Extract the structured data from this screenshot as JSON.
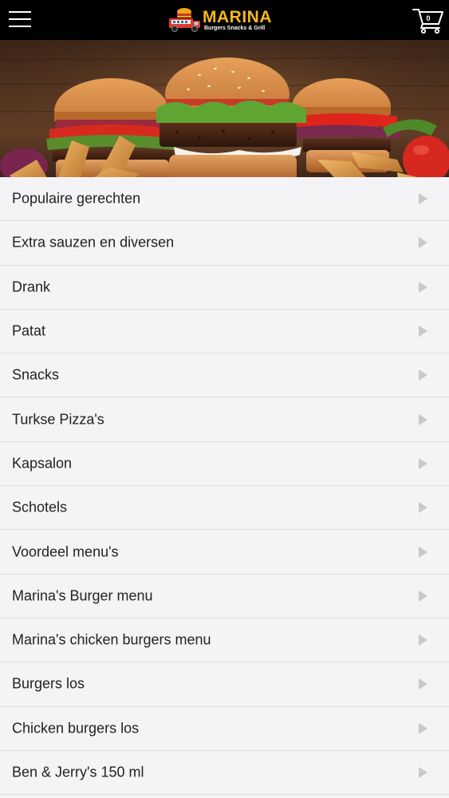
{
  "header": {
    "menu_icon": "hamburger-menu-icon",
    "brand": {
      "name": "MARINA",
      "tagline": "Burgers Snacks & Grill",
      "logo_icon": "food-truck-logo"
    },
    "cart": {
      "icon": "shopping-cart-icon",
      "count": "0"
    }
  },
  "banner": {
    "image": "burgers-and-potato-wedges-photo"
  },
  "categories": [
    {
      "label": "Populaire gerechten"
    },
    {
      "label": "Extra sauzen en diversen"
    },
    {
      "label": "Drank"
    },
    {
      "label": "Patat"
    },
    {
      "label": "Snacks"
    },
    {
      "label": "Turkse Pizza's"
    },
    {
      "label": "Kapsalon"
    },
    {
      "label": "Schotels"
    },
    {
      "label": "Voordeel menu's"
    },
    {
      "label": "Marina's Burger menu"
    },
    {
      "label": "Marina's chicken burgers menu"
    },
    {
      "label": "Burgers los"
    },
    {
      "label": "Chicken burgers los"
    },
    {
      "label": "Ben & Jerry's 150 ml"
    }
  ],
  "colors": {
    "header_bg": "#000000",
    "brand_yellow": "#f6b820",
    "list_bg": "#f4f4f6",
    "divider": "#dcdce0",
    "chevron": "#c9c9cd"
  }
}
